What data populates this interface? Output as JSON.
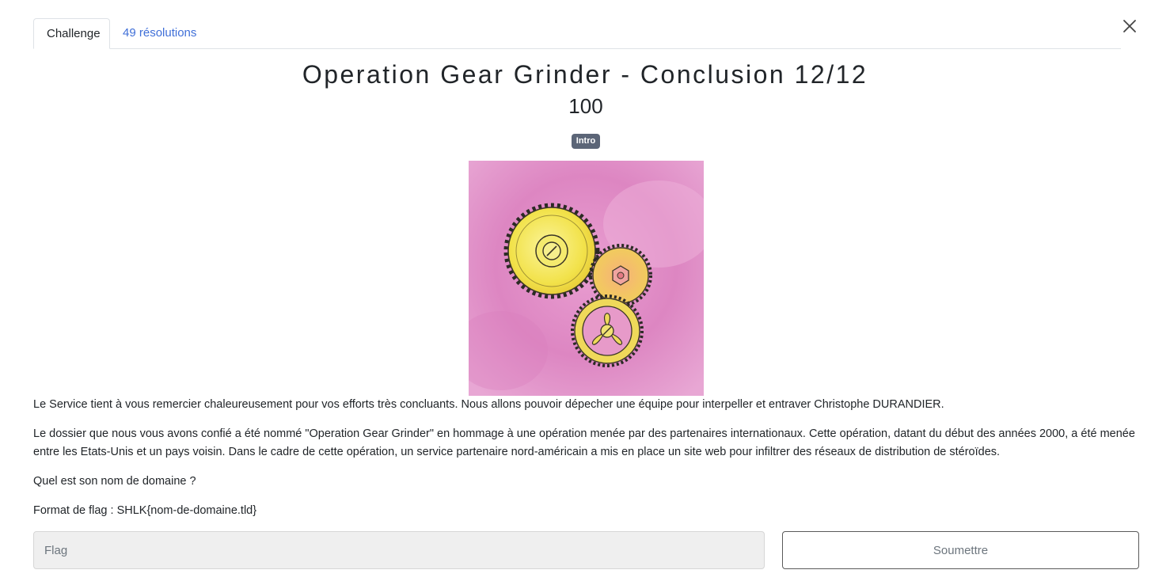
{
  "tabs": {
    "challenge": "Challenge",
    "solves": "49 résolutions"
  },
  "challenge": {
    "title": "Operation Gear Grinder - Conclusion 12/12",
    "points": "100",
    "tag": "Intro"
  },
  "description": {
    "p1": "Le Service tient à vous remercier chaleureusement pour vos efforts très concluants. Nous allons pouvoir dépecher une équipe pour interpeller et entraver Christophe DURANDIER.",
    "p2": "Le dossier que nous vous avons confié a été nommé \"Operation Gear Grinder\" en hommage à une opération menée par des partenaires internationaux. Cette opération, datant du début des années 2000, a été menée entre les Etats-Unis et un pays voisin. Dans le cadre de cette opération, un service partenaire nord-américain a mis en place un site web pour infiltrer des réseaux de distribution de stéroïdes.",
    "p3": "Quel est son nom de domaine ?",
    "p4": "Format de flag : SHLK{nom-de-domaine.tld}"
  },
  "form": {
    "flag_placeholder": "Flag",
    "flag_value": "",
    "submit_label": "Soumettre"
  },
  "icons": {
    "close": "close-icon"
  },
  "colors": {
    "link": "#3f6fd8",
    "tag_bg": "#5b6577",
    "input_bg": "#efefef"
  }
}
